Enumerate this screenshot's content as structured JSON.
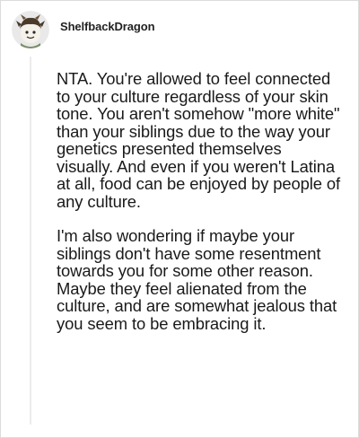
{
  "post": {
    "username": "ShelfbackDragon",
    "avatar_icon": "dragon-avatar-icon",
    "paragraphs": [
      "NTA. You're allowed to feel connected to your culture regardless of your skin tone. You aren't somehow \"more white\" than your siblings due to the way your genetics presented themselves visually. And even if you weren't Latina at all, food can be enjoyed by people of any culture.",
      "I'm also wondering if maybe your siblings don't have some resentment towards you for some other reason. Maybe they feel alienated from the culture, and are somewhat jealous that you seem to be embracing it."
    ]
  },
  "colors": {
    "avatar_bg": "#e9e9e9",
    "avatar_face": "#f6f2ea",
    "avatar_hair": "#4a3b2a",
    "thread_line": "#ececec"
  }
}
